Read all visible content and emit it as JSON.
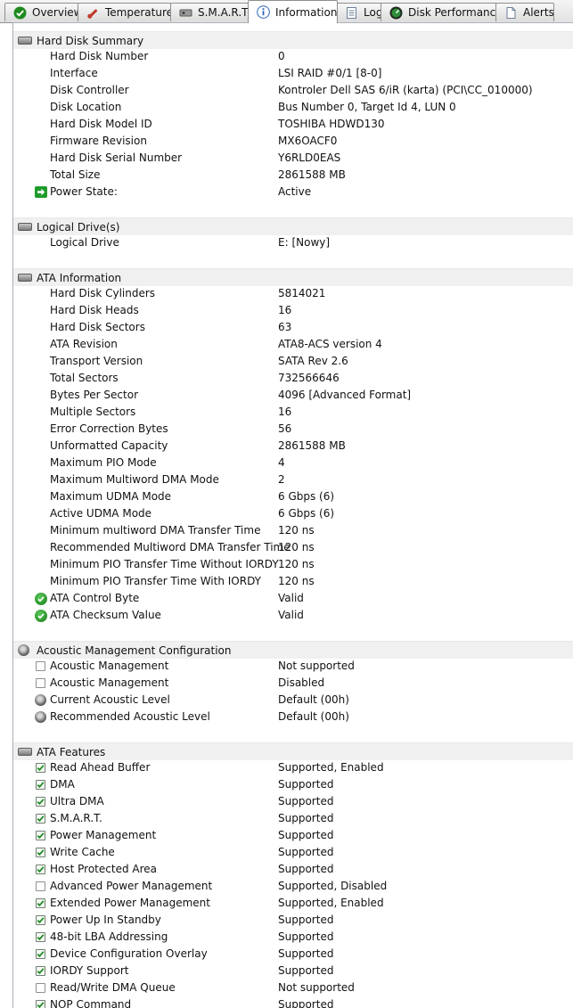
{
  "tabs": [
    {
      "label": "Overview",
      "icon": "green-check-icon",
      "active": false
    },
    {
      "label": "Temperature",
      "icon": "thermometer-icon",
      "active": false
    },
    {
      "label": "S.M.A.R.T.",
      "icon": "smart-disk-icon",
      "active": false
    },
    {
      "label": "Information",
      "icon": "info-icon",
      "active": true
    },
    {
      "label": "Log",
      "icon": "log-icon",
      "active": false
    },
    {
      "label": "Disk Performance",
      "icon": "gauge-icon",
      "active": false
    },
    {
      "label": "Alerts",
      "icon": "document-icon",
      "active": false
    }
  ],
  "groups": [
    {
      "title": "Hard Disk Summary",
      "icon": "disk-icon",
      "rows": [
        {
          "label": "Hard Disk Number",
          "value": "0",
          "icon": "none"
        },
        {
          "label": "Interface",
          "value": "LSI  RAID #0/1 [8-0]",
          "icon": "none"
        },
        {
          "label": "Disk Controller",
          "value": "Kontroler Dell SAS 6/iR (karta) (PCI\\CC_010000)",
          "icon": "none"
        },
        {
          "label": "Disk Location",
          "value": "Bus Number 0, Target Id 4, LUN 0",
          "icon": "none"
        },
        {
          "label": "Hard Disk Model ID",
          "value": "TOSHIBA HDWD130",
          "icon": "none"
        },
        {
          "label": "Firmware Revision",
          "value": "MX6OACF0",
          "icon": "none"
        },
        {
          "label": "Hard Disk Serial Number",
          "value": "Y6RLD0EAS",
          "icon": "none"
        },
        {
          "label": "Total Size",
          "value": "2861588 MB",
          "icon": "none"
        },
        {
          "label": "Power State:",
          "value": "Active",
          "icon": "arrow"
        }
      ]
    },
    {
      "title": "Logical Drive(s)",
      "icon": "disk-icon",
      "rows": [
        {
          "label": "Logical Drive",
          "value": "E: [Nowy]",
          "icon": "none"
        }
      ]
    },
    {
      "title": "ATA Information",
      "icon": "disk-icon",
      "rows": [
        {
          "label": "Hard Disk Cylinders",
          "value": "5814021",
          "icon": "none"
        },
        {
          "label": "Hard Disk Heads",
          "value": "16",
          "icon": "none"
        },
        {
          "label": "Hard Disk Sectors",
          "value": "63",
          "icon": "none"
        },
        {
          "label": "ATA Revision",
          "value": "ATA8-ACS version 4",
          "icon": "none"
        },
        {
          "label": "Transport Version",
          "value": "SATA Rev 2.6",
          "icon": "none"
        },
        {
          "label": "Total Sectors",
          "value": "732566646",
          "icon": "none"
        },
        {
          "label": "Bytes Per Sector",
          "value": "4096 [Advanced Format]",
          "icon": "none"
        },
        {
          "label": "Multiple Sectors",
          "value": "16",
          "icon": "none"
        },
        {
          "label": "Error Correction Bytes",
          "value": "56",
          "icon": "none"
        },
        {
          "label": "Unformatted Capacity",
          "value": "2861588 MB",
          "icon": "none"
        },
        {
          "label": "Maximum PIO Mode",
          "value": "4",
          "icon": "none"
        },
        {
          "label": "Maximum Multiword DMA Mode",
          "value": "2",
          "icon": "none"
        },
        {
          "label": "Maximum UDMA Mode",
          "value": "6 Gbps (6)",
          "icon": "none"
        },
        {
          "label": "Active UDMA Mode",
          "value": "6 Gbps (6)",
          "icon": "none"
        },
        {
          "label": "Minimum multiword DMA Transfer Time",
          "value": "120 ns",
          "icon": "none"
        },
        {
          "label": "Recommended Multiword DMA Transfer Time",
          "value": "120 ns",
          "icon": "none"
        },
        {
          "label": "Minimum PIO Transfer Time Without IORDY",
          "value": "120 ns",
          "icon": "none"
        },
        {
          "label": "Minimum PIO Transfer Time With IORDY",
          "value": "120 ns",
          "icon": "none"
        },
        {
          "label": "ATA Control Byte",
          "value": "Valid",
          "icon": "ok"
        },
        {
          "label": "ATA Checksum Value",
          "value": "Valid",
          "icon": "ok"
        }
      ]
    },
    {
      "title": "Acoustic Management Configuration",
      "icon": "speaker-icon",
      "rows": [
        {
          "label": "Acoustic Management",
          "value": "Not supported",
          "icon": "unchecked"
        },
        {
          "label": "Acoustic Management",
          "value": "Disabled",
          "icon": "unchecked"
        },
        {
          "label": "Current Acoustic Level",
          "value": "Default (00h)",
          "icon": "speaker"
        },
        {
          "label": "Recommended Acoustic Level",
          "value": "Default (00h)",
          "icon": "speaker"
        }
      ]
    },
    {
      "title": "ATA Features",
      "icon": "disk-icon",
      "rows": [
        {
          "label": "Read Ahead Buffer",
          "value": "Supported, Enabled",
          "icon": "checked"
        },
        {
          "label": "DMA",
          "value": "Supported",
          "icon": "checked"
        },
        {
          "label": "Ultra DMA",
          "value": "Supported",
          "icon": "checked"
        },
        {
          "label": "S.M.A.R.T.",
          "value": "Supported",
          "icon": "checked"
        },
        {
          "label": "Power Management",
          "value": "Supported",
          "icon": "checked"
        },
        {
          "label": "Write Cache",
          "value": "Supported",
          "icon": "checked"
        },
        {
          "label": "Host Protected Area",
          "value": "Supported",
          "icon": "checked"
        },
        {
          "label": "Advanced Power Management",
          "value": "Supported, Disabled",
          "icon": "unchecked"
        },
        {
          "label": "Extended Power Management",
          "value": "Supported, Enabled",
          "icon": "checked"
        },
        {
          "label": "Power Up In Standby",
          "value": "Supported",
          "icon": "checked"
        },
        {
          "label": "48-bit LBA Addressing",
          "value": "Supported",
          "icon": "checked"
        },
        {
          "label": "Device Configuration Overlay",
          "value": "Supported",
          "icon": "checked"
        },
        {
          "label": "IORDY Support",
          "value": "Supported",
          "icon": "checked"
        },
        {
          "label": "Read/Write DMA Queue",
          "value": "Not supported",
          "icon": "unchecked"
        },
        {
          "label": "NOP Command",
          "value": "Supported",
          "icon": "checked"
        }
      ]
    }
  ]
}
